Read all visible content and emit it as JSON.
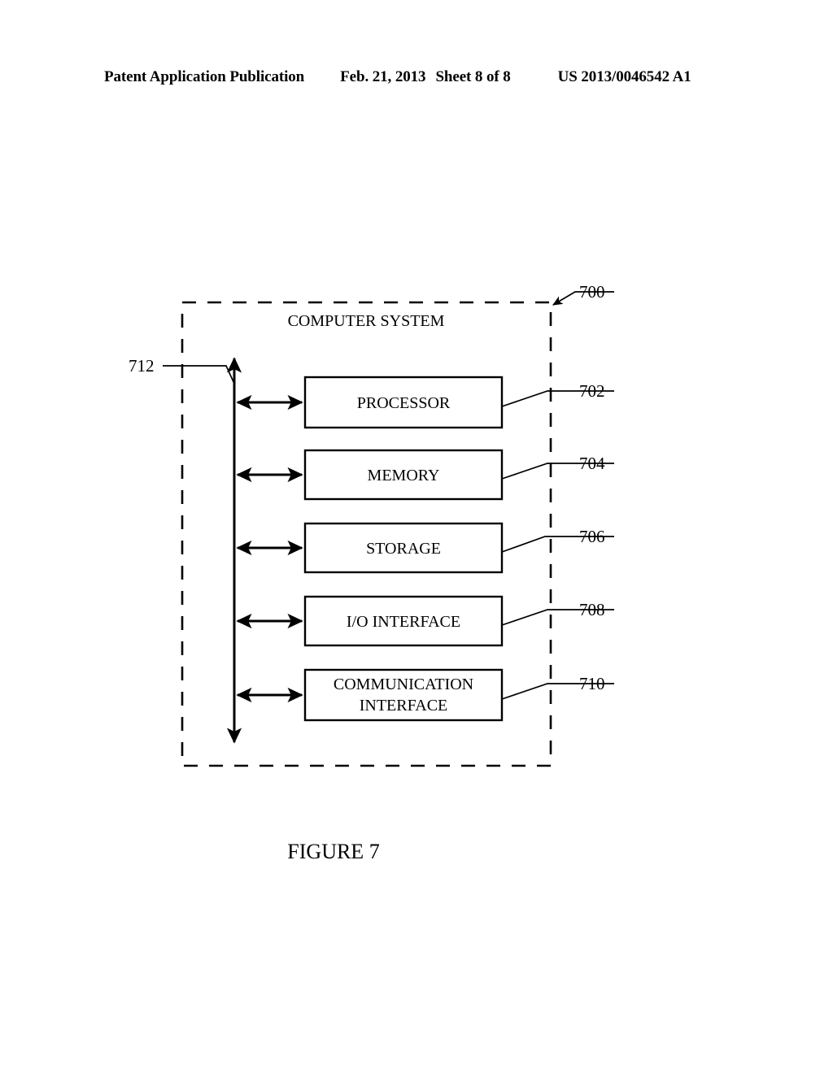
{
  "header": {
    "publication": "Patent Application Publication",
    "date": "Feb. 21, 2013",
    "sheet": "Sheet 8 of 8",
    "document_number": "US 2013/0046542 A1"
  },
  "figure": {
    "caption": "FIGURE 7",
    "system_title": "COMPUTER SYSTEM",
    "system_ref": "700",
    "bus_ref": "712",
    "modules": [
      {
        "label": "PROCESSOR",
        "ref": "702"
      },
      {
        "label": "MEMORY",
        "ref": "704"
      },
      {
        "label": "STORAGE",
        "ref": "706"
      },
      {
        "label": "I/O INTERFACE",
        "ref": "708"
      },
      {
        "label_line1": "COMMUNICATION",
        "label_line2": "INTERFACE",
        "ref": "710"
      }
    ]
  },
  "colors": {
    "ink": "#000000",
    "paper": "#ffffff"
  }
}
